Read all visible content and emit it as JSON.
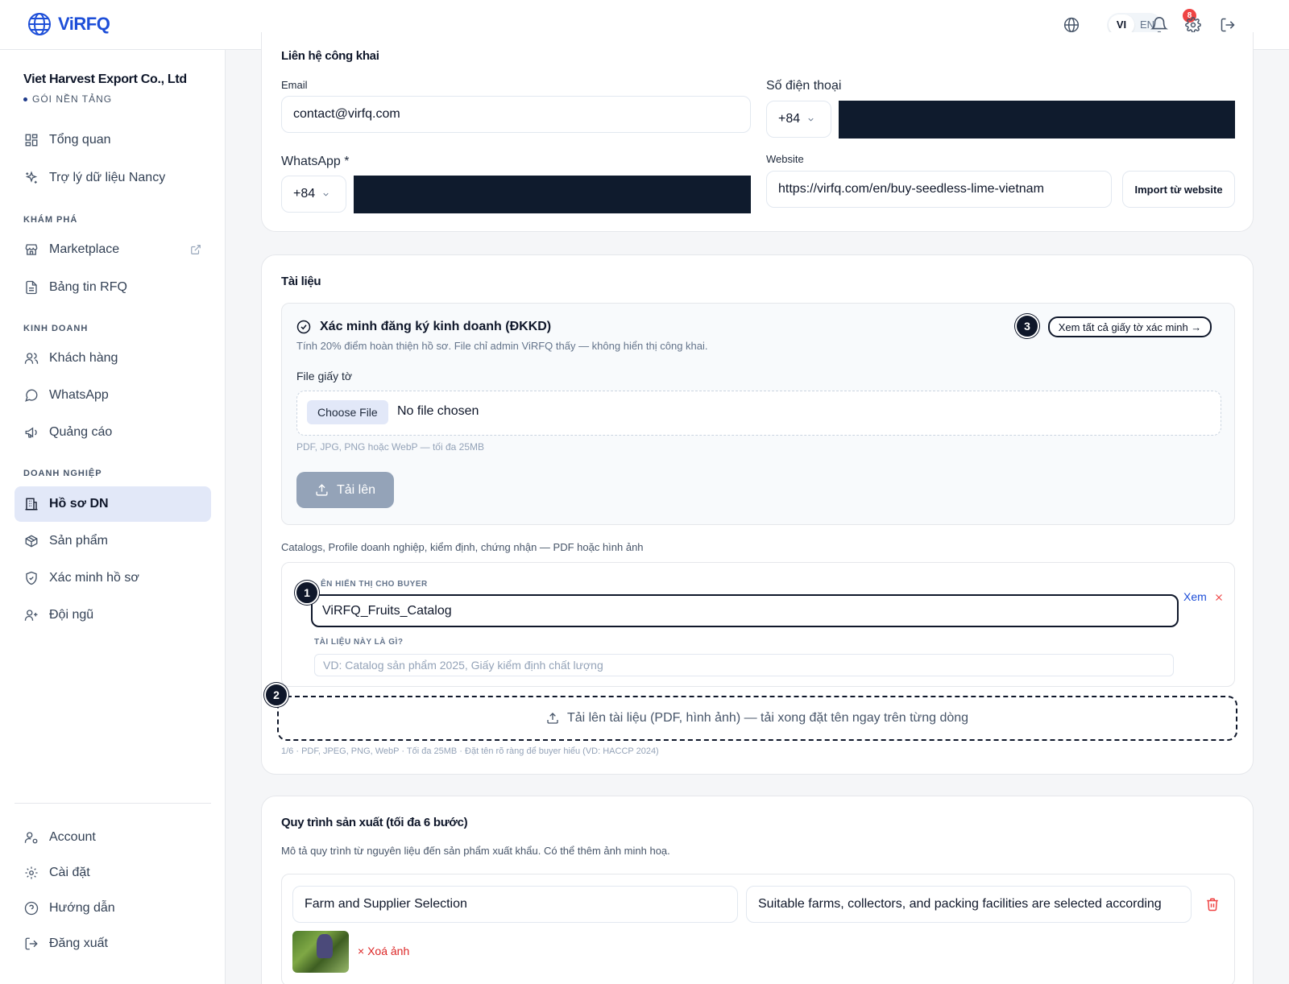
{
  "header": {
    "logo_text": "ViRFQ",
    "lang_vi": "VI",
    "lang_en": "EN",
    "notification_count": "8"
  },
  "sidebar": {
    "company_name": "Viet Harvest Export Co., Ltd",
    "plan": "GÓI NỀN TẢNG",
    "items_top": [
      {
        "label": "Tổng quan",
        "icon": "grid-icon"
      },
      {
        "label": "Trợ lý dữ liệu Nancy",
        "icon": "sparkles-icon"
      }
    ],
    "section_explore": "KHÁM PHÁ",
    "items_explore": [
      {
        "label": "Marketplace",
        "icon": "store-icon"
      },
      {
        "label": "Bảng tin RFQ",
        "icon": "document-icon"
      }
    ],
    "section_business": "KINH DOANH",
    "items_business": [
      {
        "label": "Khách hàng",
        "icon": "users-icon"
      },
      {
        "label": "WhatsApp",
        "icon": "chat-icon"
      },
      {
        "label": "Quảng cáo",
        "icon": "megaphone-icon"
      }
    ],
    "section_company": "DOANH NGHIỆP",
    "items_company": [
      {
        "label": "Hồ sơ DN",
        "icon": "building-icon",
        "active": true
      },
      {
        "label": "Sản phẩm",
        "icon": "package-icon"
      },
      {
        "label": "Xác minh hồ sơ",
        "icon": "shield-check-icon"
      },
      {
        "label": "Đội ngũ",
        "icon": "user-plus-icon"
      }
    ],
    "items_bottom": [
      {
        "label": "Account",
        "icon": "user-cog-icon"
      },
      {
        "label": "Cài đặt",
        "icon": "gear-icon"
      },
      {
        "label": "Hướng dẫn",
        "icon": "help-icon"
      },
      {
        "label": "Đăng xuất",
        "icon": "logout-icon"
      }
    ]
  },
  "contact": {
    "title": "Liên hệ công khai",
    "email_label": "Email",
    "email_value": "contact@virfq.com",
    "phone_label": "Số điện thoại",
    "phone_cc": "+84",
    "whatsapp_label": "WhatsApp *",
    "whatsapp_cc": "+84",
    "website_label": "Website",
    "website_value": "https://virfq.com/en/buy-seedless-lime-vietnam",
    "import_button": "Import từ website"
  },
  "documents": {
    "title": "Tài liệu",
    "verify_title": "Xác minh đăng ký kinh doanh (ĐKKD)",
    "verify_desc": "Tính 20% điểm hoàn thiện hồ sơ. File chỉ admin ViRFQ thấy — không hiển thị công khai.",
    "see_all": "Xem tất cả giấy tờ xác minh →",
    "file_label": "File giấy tờ",
    "choose_file": "Choose File",
    "no_file": "No file chosen",
    "file_hint": "PDF, JPG, PNG hoặc WebP — tối đa 25MB",
    "upload_button": "Tải lên",
    "catalog_desc": "Catalogs, Profile doanh nghiệp, kiểm định, chứng nhận — PDF hoặc hình ảnh",
    "display_name_label": "ÊN HIỂN THỊ CHO BUYER",
    "display_name_value": "ViRFQ_Fruits_Catalog",
    "what_label": "TÀI LIỆU NÀY LÀ GÌ?",
    "what_placeholder": "VD: Catalog sản phẩm 2025, Giấy kiểm định chất lượng",
    "view_link": "Xem",
    "dropzone_text": "Tải lên tài liệu (PDF, hình ảnh) — tải xong đặt tên ngay trên từng dòng",
    "footnote": "1/6 · PDF, JPEG, PNG, WebP · Tối đa 25MB · Đặt tên rõ ràng để buyer hiểu (VD: HACCP 2024)",
    "marker_1": "1",
    "marker_2": "2",
    "marker_3": "3"
  },
  "process": {
    "title": "Quy trình sản xuất (tối đa 6 bước)",
    "desc": "Mô tả quy trình từ nguyên liệu đến sản phẩm xuất khẩu. Có thể thêm ảnh minh hoạ.",
    "step1_title": "Farm and Supplier Selection",
    "step1_desc": "Suitable farms, collectors, and packing facilities are selected according",
    "delete_image": "× Xoá ảnh"
  },
  "colors": {
    "brand": "#1d4ed8",
    "active_nav": "#e2e8f8",
    "redaction": "#0f1b2d",
    "danger": "#ef4444"
  }
}
